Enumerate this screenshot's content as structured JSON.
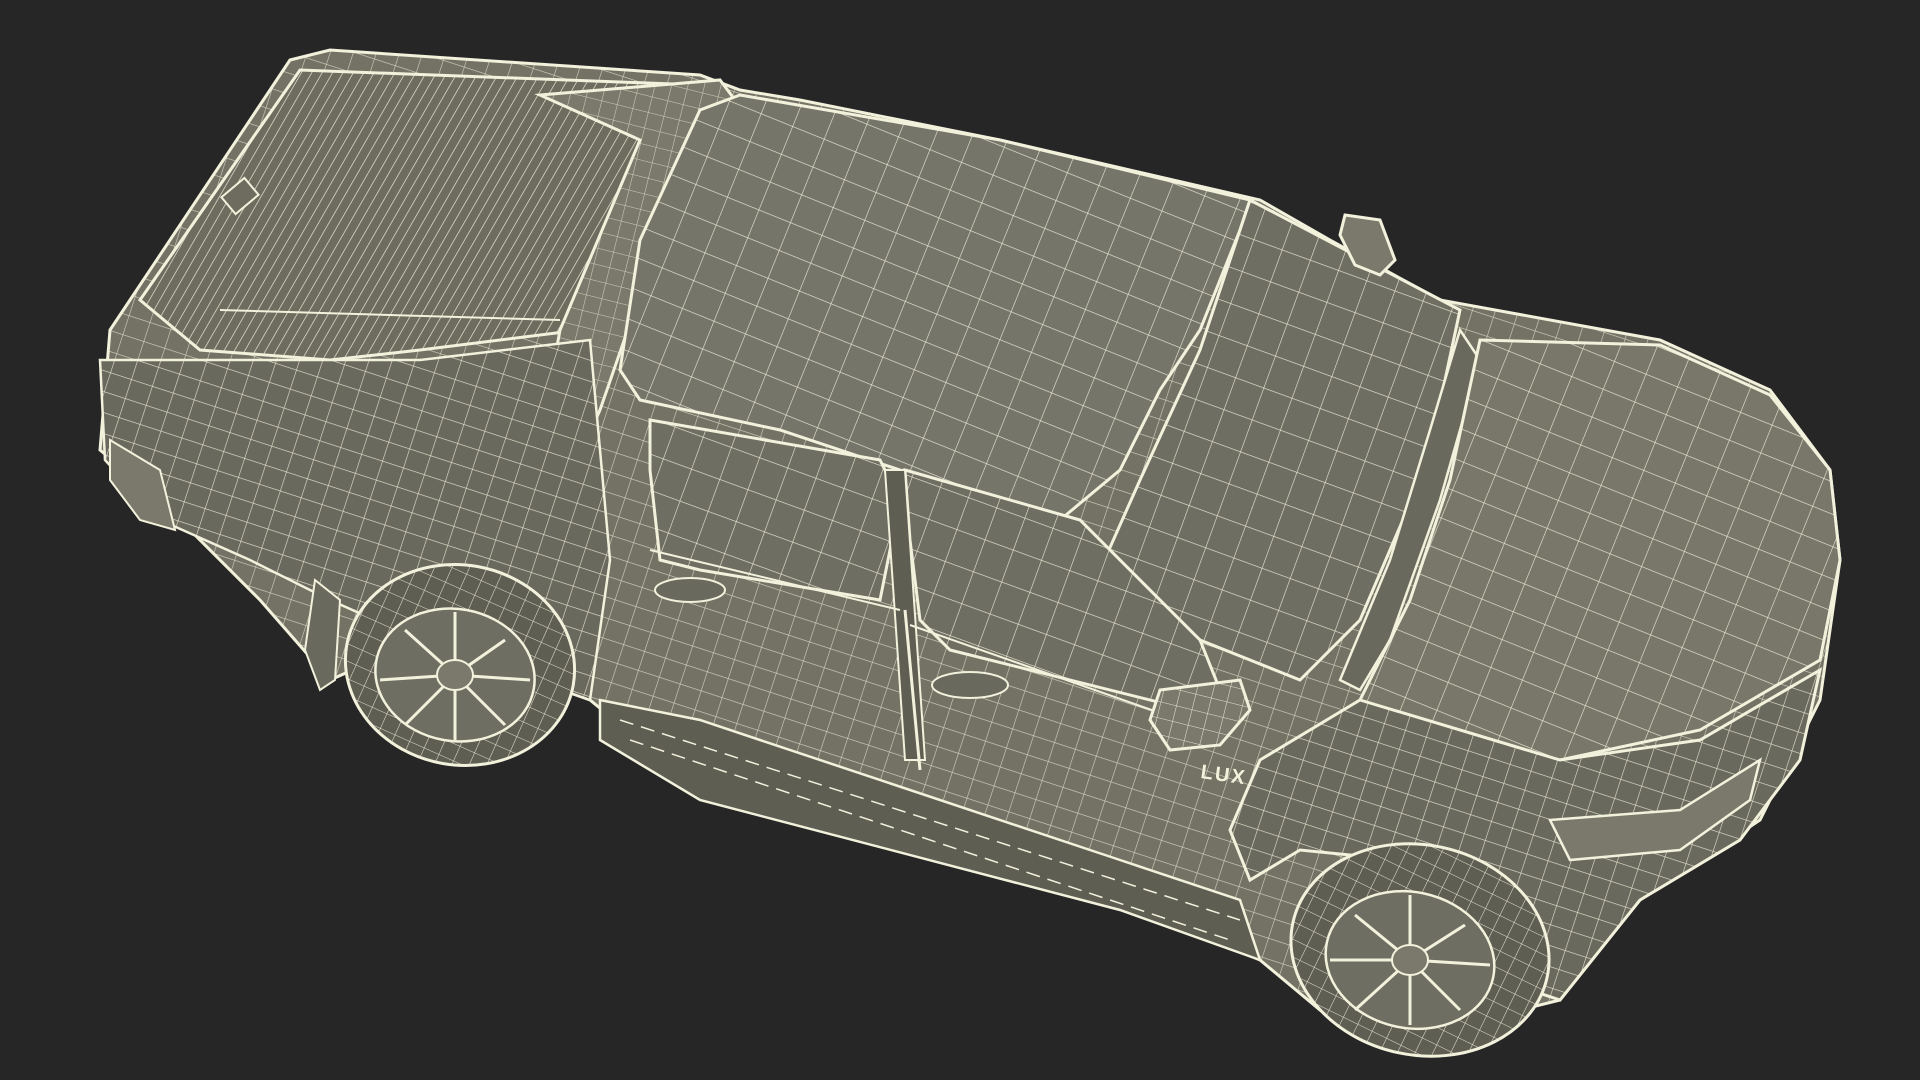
{
  "scene": {
    "background_color": "#262626",
    "surface_color": "#737265",
    "surface_dark_color": "#5f5e53",
    "wire_color": "#f2f1dc"
  },
  "model": {
    "badge_text": "LUX"
  }
}
